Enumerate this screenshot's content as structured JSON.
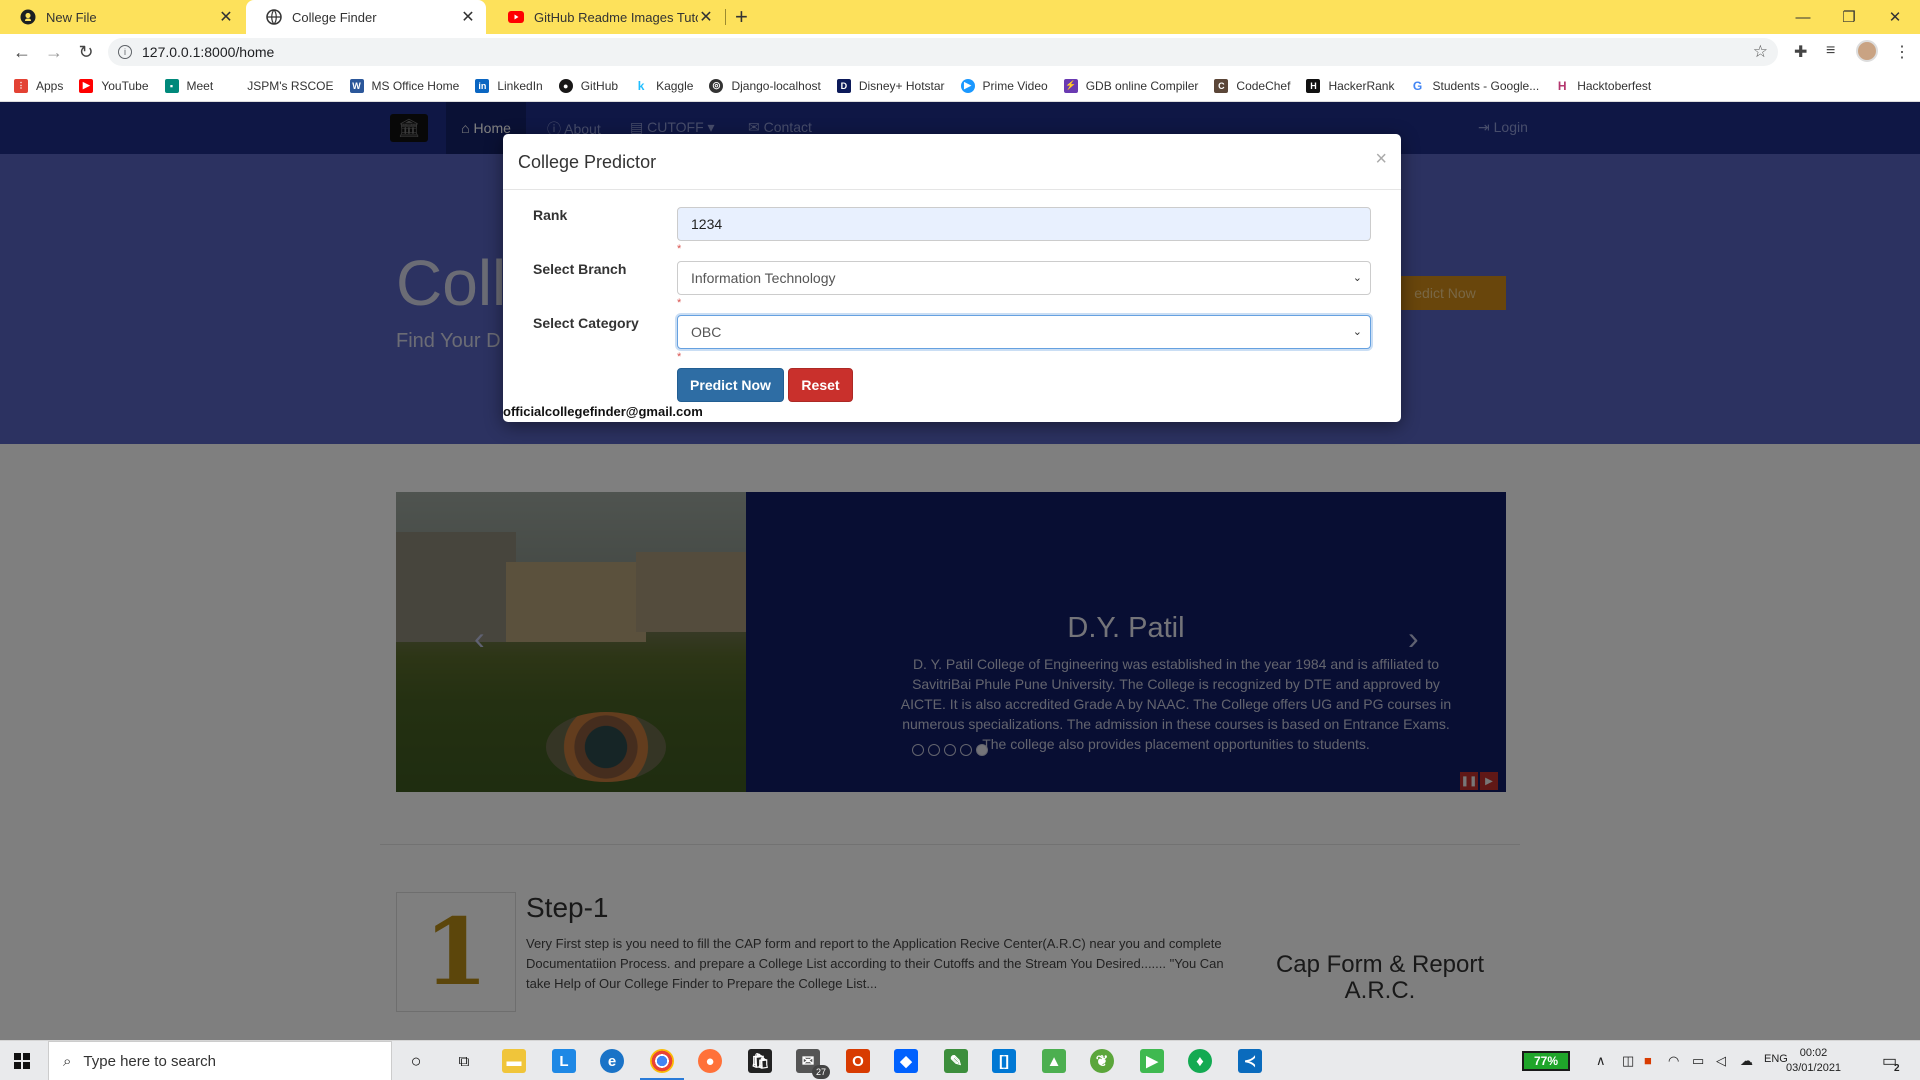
{
  "browser": {
    "tabs": [
      {
        "title": "New File",
        "icon": "github-icon"
      },
      {
        "title": "College Finder",
        "icon": "globe-icon"
      },
      {
        "title": "GitHub Readme Images Tutorial",
        "icon": "youtube-icon"
      }
    ],
    "url": "127.0.0.1:8000/home",
    "bookmarks": [
      {
        "label": "Apps",
        "color": "#e34234"
      },
      {
        "label": "YouTube",
        "color": "#ff0000"
      },
      {
        "label": "Meet",
        "color": "#00897b"
      },
      {
        "label": "JSPM's RSCOE",
        "color": "#ffffff"
      },
      {
        "label": "MS Office Home",
        "color": "#2b579a"
      },
      {
        "label": "LinkedIn",
        "color": "#0a66c2"
      },
      {
        "label": "GitHub",
        "color": "#181717"
      },
      {
        "label": "Kaggle",
        "color": "#20beff"
      },
      {
        "label": "Django-localhost",
        "color": "#333333"
      },
      {
        "label": "Disney+ Hotstar",
        "color": "#0c1a5a"
      },
      {
        "label": "Prime Video",
        "color": "#1a98ff"
      },
      {
        "label": "GDB online Compiler",
        "color": "#6a3ab2"
      },
      {
        "label": "CodeChef",
        "color": "#5b4638"
      },
      {
        "label": "HackerRank",
        "color": "#1ba94c"
      },
      {
        "label": "Students - Google...",
        "color": "#4285f4"
      },
      {
        "label": "Hacktoberfest",
        "color": "#b4366e"
      }
    ]
  },
  "site": {
    "nav": {
      "home": "Home",
      "about": "About",
      "cutoff": "CUTOFF",
      "contact": "Contact",
      "login": "Login"
    },
    "hero": {
      "title": "Coll",
      "subtitle": "Find Your D",
      "button": "edict Now"
    },
    "carousel": {
      "title": "D.Y. Patil",
      "description": "D. Y. Patil College of Engineering was established in the year 1984 and is affiliated to SavitriBai Phule Pune University. The College is recognized by DTE and approved by AICTE. It is also accredited Grade A by NAAC. The College offers UG and PG courses in numerous specializations. The admission in these courses is based on Entrance Exams. The college also provides placement opportunities to students.",
      "slide_count": 5,
      "active_slide": 5
    },
    "step": {
      "number": "1",
      "title": "Step-1",
      "text": "Very First step is you need to fill the CAP form and report to the Application Recive Center(A.R.C) near you and complete Documentatiion Process. and prepare a College List according to their Cutoffs and the Stream You Desired....... \"You Can take Help of Our College Finder to Prepare the College List...",
      "side_line1": "Cap Form & Report",
      "side_line2": "A.R.C."
    }
  },
  "modal": {
    "title": "College Predictor",
    "close": "×",
    "rank_label": "Rank",
    "rank_value": "1234",
    "branch_label": "Select Branch",
    "branch_value": "Information Technology",
    "category_label": "Select Category",
    "category_value": "OBC",
    "required_mark": "*",
    "predict_button": "Predict Now",
    "reset_button": "Reset",
    "email": "officialcollegefinder@gmail.com"
  },
  "taskbar": {
    "search_placeholder": "Type here to search",
    "battery": "77%",
    "language": "ENG",
    "time": "00:02",
    "date": "03/01/2021",
    "mail_badge": "27",
    "notification_count": "2"
  },
  "colors": {
    "tabstrip": "#fde15b",
    "site_nav": "#1e2f8a",
    "primary_button": "#2e6da4",
    "danger_button": "#c9302c"
  }
}
